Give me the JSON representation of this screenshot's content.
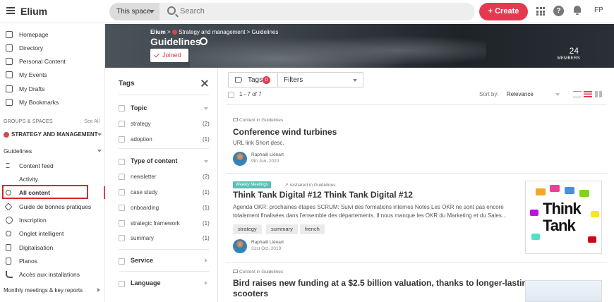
{
  "topbar": {
    "brand": "Elium",
    "scope_label": "This space",
    "search_placeholder": "Search",
    "create_label": "+ Create",
    "help_glyph": "?",
    "user_initials": "FP"
  },
  "sidebar": {
    "main_items": [
      {
        "label": "Homepage",
        "icon": "home-icon"
      },
      {
        "label": "Directory",
        "icon": "directory-icon"
      },
      {
        "label": "Personal Content",
        "icon": "document-icon"
      },
      {
        "label": "My Events",
        "icon": "calendar-icon"
      },
      {
        "label": "My Drafts",
        "icon": "drafts-icon"
      },
      {
        "label": "My Bookmarks",
        "icon": "bookmark-icon"
      }
    ],
    "groups_header": "GROUPS & SPACES",
    "see_all": "See All",
    "group_name": "STRATEGY AND MANAGEMENT",
    "space_name": "Guidelines",
    "space_items": [
      {
        "label": "Content feed",
        "icon": "list-icon"
      },
      {
        "label": "Activity",
        "icon": "activity-icon"
      },
      {
        "label": "All content",
        "icon": "search-icon"
      },
      {
        "label": "Guide de bonnes pratiques",
        "icon": "layers-icon"
      },
      {
        "label": "Inscription",
        "icon": "globe-icon"
      },
      {
        "label": "Onglet intelligent",
        "icon": "search-icon"
      },
      {
        "label": "Digitalisation",
        "icon": "document-icon"
      },
      {
        "label": "Planos",
        "icon": "document-icon"
      },
      {
        "label": "Accès aux installations",
        "icon": "phone-icon"
      }
    ],
    "bottom_group": "Monthly meetings & key reports"
  },
  "banner": {
    "crumb_root": "Elium",
    "crumb_group": "Strategy and management",
    "crumb_space": "Guidelines",
    "title": "Guidelines",
    "joined_label": "Joined",
    "members_count": "24",
    "members_label": "MEMBERS"
  },
  "tags_panel": {
    "title": "Tags",
    "topic": {
      "header": "Topic",
      "items": [
        {
          "label": "strategy",
          "count": "(2)"
        },
        {
          "label": "adoption",
          "count": "(1)"
        }
      ]
    },
    "type": {
      "header": "Type of content",
      "items": [
        {
          "label": "newsletter",
          "count": "(2)"
        },
        {
          "label": "case study",
          "count": "(1)"
        },
        {
          "label": "onboarding",
          "count": "(1)"
        },
        {
          "label": "strategic framework",
          "count": "(1)"
        },
        {
          "label": "summary",
          "count": "(1)"
        }
      ]
    },
    "service_header": "Service",
    "language_header": "Language"
  },
  "results_bar": {
    "tags_label": "Tags",
    "tags_badge": "0",
    "filters_label": "Filters",
    "count_text": "1 - 7 of 7",
    "sort_label": "Sort by:",
    "sort_value": "Relevance"
  },
  "results": [
    {
      "meta": "Content in Guidelines",
      "title": "Conference wind turbines",
      "desc": "URL link Short desc.",
      "author": "Raphaël Liénart",
      "date": "9th Jun, 2020"
    },
    {
      "badge": "Weekly Meetings",
      "meta": "reshared in Guidelines",
      "title": "Think Tank Digital #12 Think Tank Digital #12",
      "desc_line1": "Agenda OKR: prochaines étapes SCRUM: Suivi des formations internes Notes Les OKR ne sont pas encore",
      "desc_line2": "totalement finalisées dans l'ensemble des départements. Il nous manque les OKR du Marketing et du Sales...",
      "chips": [
        "strategy",
        "summary",
        "french"
      ],
      "author": "Raphaël Liénart",
      "date": "31st Oct, 2019",
      "thumb_text_1": "Think",
      "thumb_text_2": "Tank"
    },
    {
      "meta": "Content in Guidelines",
      "title_line1": "Bird raises new funding at a $2.5 billion valuation, thanks to longer-lasting",
      "title_line2": "scooters"
    }
  ],
  "colors": {
    "accent": "#e23b4f",
    "badge_teal": "#5bbfb8",
    "highlight": "#d9262d"
  }
}
